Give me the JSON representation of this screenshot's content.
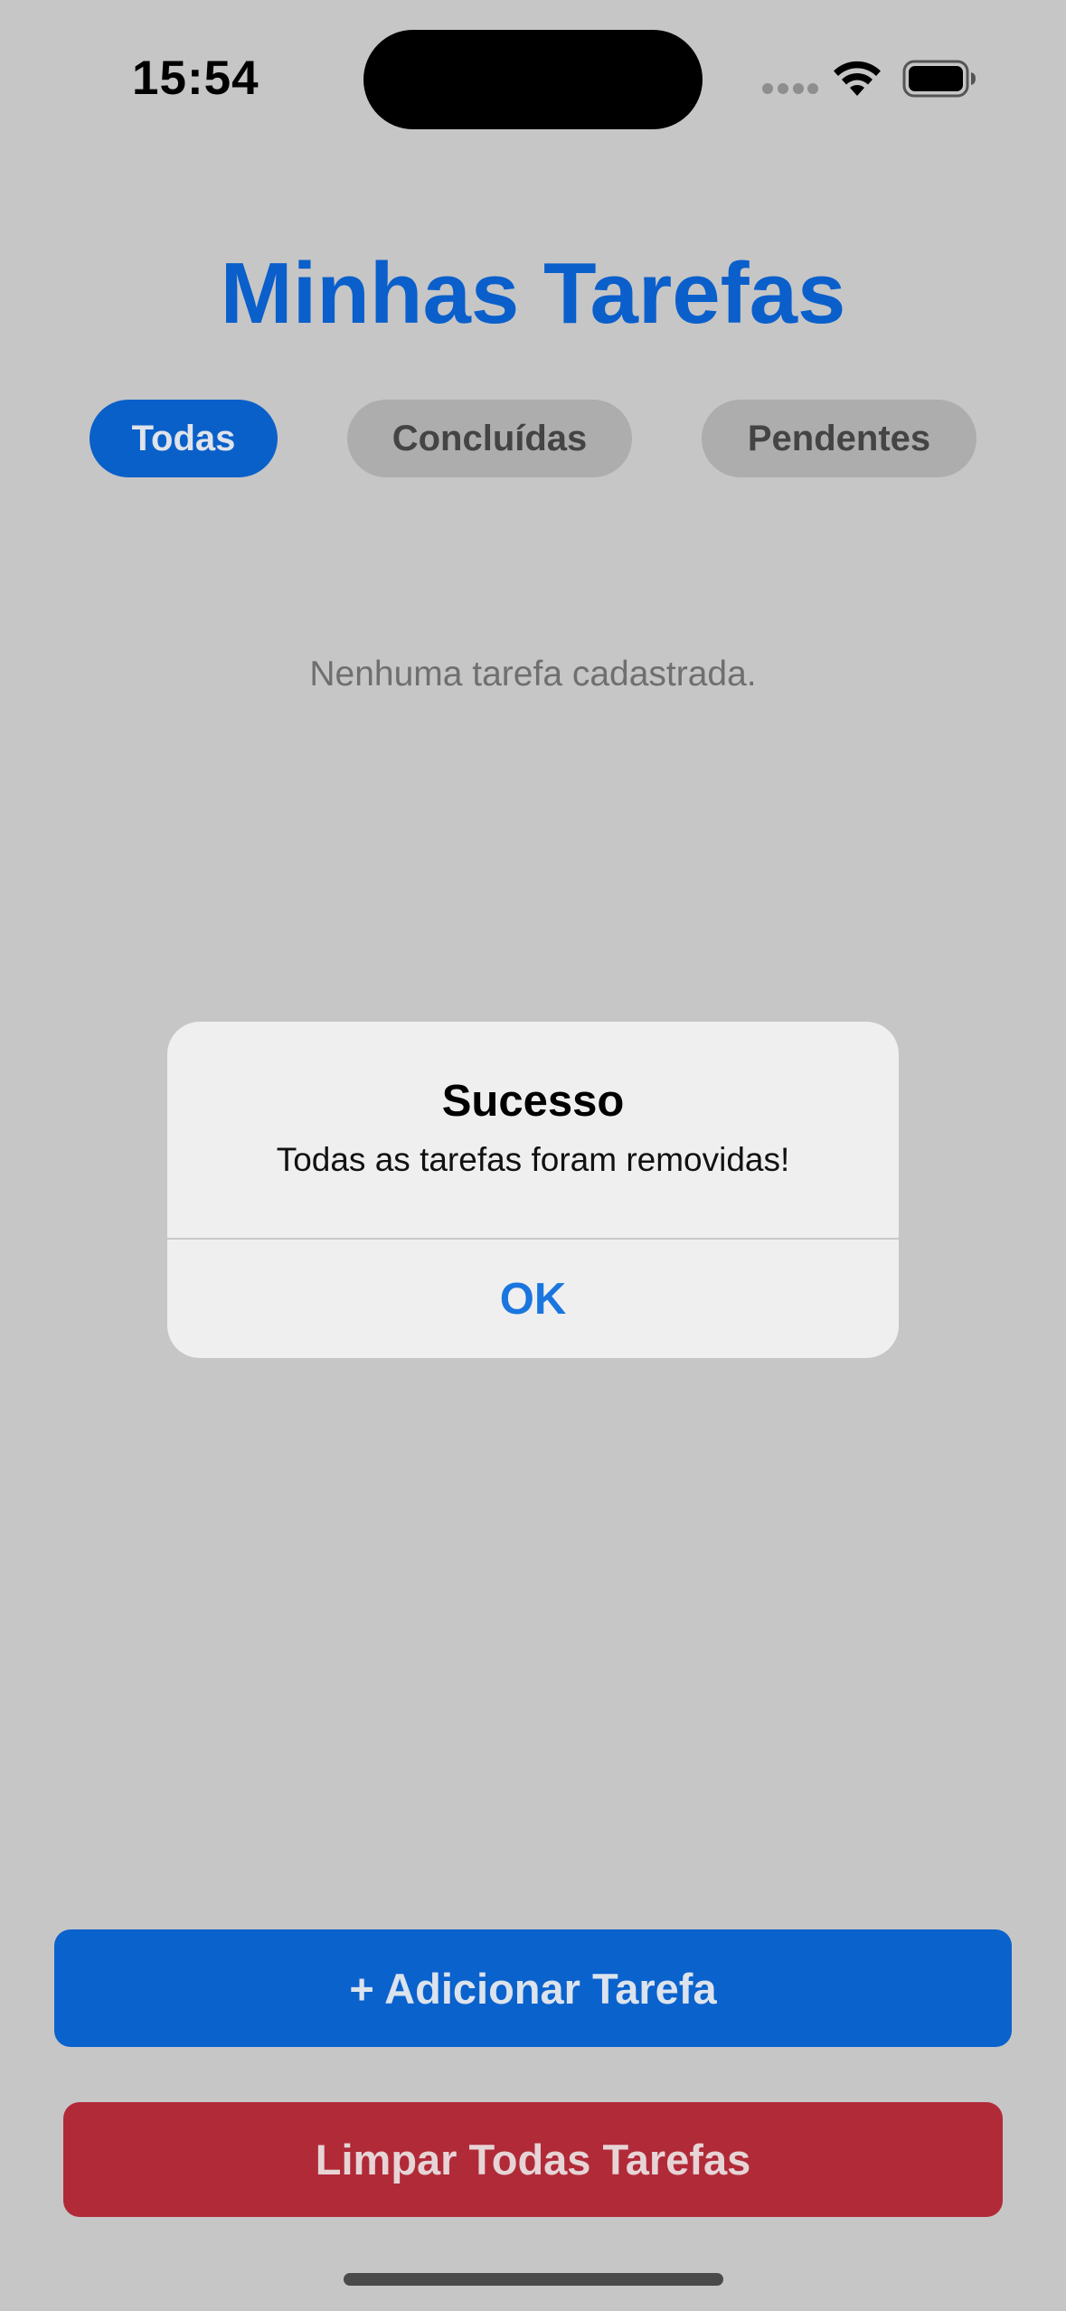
{
  "status_bar": {
    "time": "15:54"
  },
  "header": {
    "title": "Minhas Tarefas"
  },
  "filters": {
    "items": [
      {
        "label": "Todas",
        "active": true
      },
      {
        "label": "Concluídas",
        "active": false
      },
      {
        "label": "Pendentes",
        "active": false
      }
    ]
  },
  "main": {
    "empty_message": "Nenhuma tarefa cadastrada."
  },
  "alert": {
    "title": "Sucesso",
    "message": "Todas as tarefas foram removidas!",
    "ok_label": "OK"
  },
  "actions": {
    "add_label": "+ Adicionar Tarefa",
    "clear_label": "Limpar Todas Tarefas"
  },
  "colors": {
    "primary": "#0a60c9",
    "danger": "#b12a38",
    "background_dimmed": "#c6c6c6",
    "alert_button": "#1a76de"
  },
  "icons": [
    "wifi-icon",
    "battery-icon",
    "cellular-signal-icon"
  ]
}
